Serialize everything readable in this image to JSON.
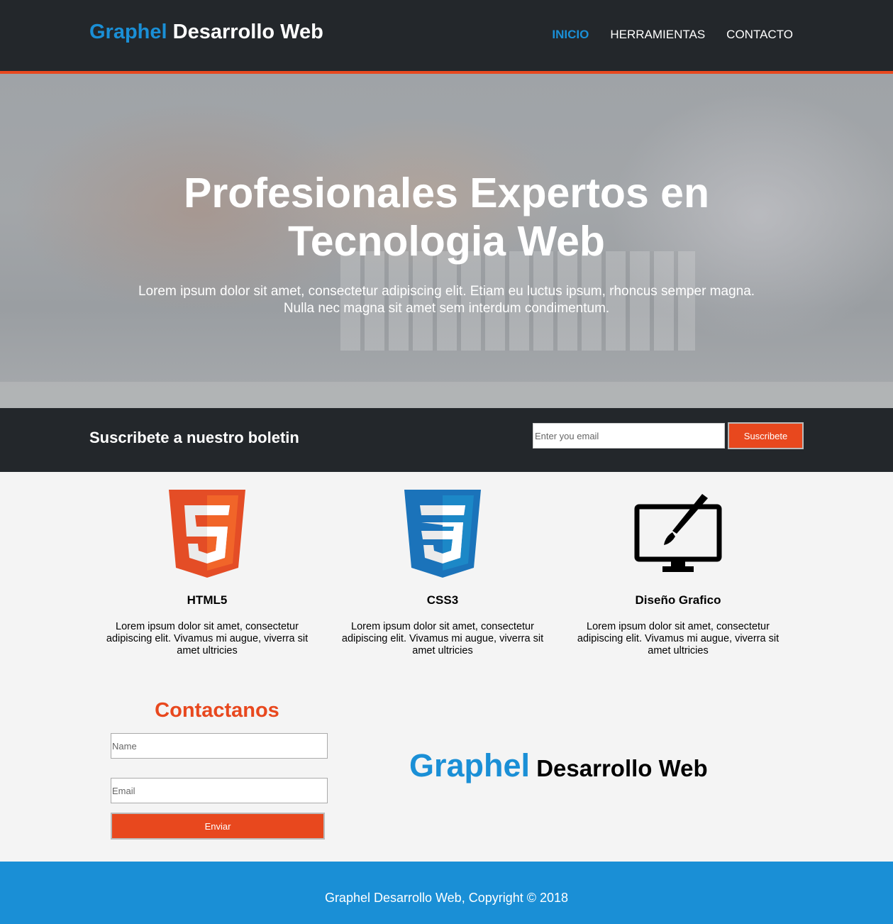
{
  "header": {
    "brand_highlight": "Graphel",
    "brand_rest": " Desarrollo Web",
    "nav": [
      {
        "label": "INICIO",
        "active": true
      },
      {
        "label": "HERRAMIENTAS",
        "active": false
      },
      {
        "label": "CONTACTO",
        "active": false
      }
    ]
  },
  "hero": {
    "title_line1": "Profesionales Expertos en",
    "title_line2": "Tecnologia Web",
    "text_line1": "Lorem ipsum dolor sit amet, consectetur adipiscing elit. Etiam eu luctus ipsum, rhoncus semper magna.",
    "text_line2": "Nulla nec magna sit amet sem interdum condimentum."
  },
  "newsletter": {
    "title": "Suscribete a nuestro boletin",
    "email_placeholder": "Enter you email",
    "button_label": "Suscribete"
  },
  "features": [
    {
      "icon": "html5-icon",
      "title": "HTML5",
      "text": "Lorem ipsum dolor sit amet, consectetur adipiscing elit. Vivamus mi augue, viverra sit amet ultricies"
    },
    {
      "icon": "css3-icon",
      "title": "CSS3",
      "text": "Lorem ipsum dolor sit amet, consectetur adipiscing elit. Vivamus mi augue, viverra sit amet ultricies"
    },
    {
      "icon": "graphic-design-monitor-icon",
      "title": "Diseño Grafico",
      "text": "Lorem ipsum dolor sit amet, consectetur adipiscing elit. Vivamus mi augue, viverra sit amet ultricies"
    }
  ],
  "contact": {
    "title": "Contactanos",
    "name_placeholder": "Name",
    "email_placeholder": "Email",
    "button_label": "Enviar"
  },
  "big_brand": {
    "highlight": "Graphel",
    "rest": " Desarrollo Web"
  },
  "footer": {
    "text": "Graphel Desarrollo Web, Copyright © 2018"
  },
  "colors": {
    "accent_orange": "#e8481e",
    "brand_blue": "#1a8fd6",
    "dark": "#23272b"
  }
}
